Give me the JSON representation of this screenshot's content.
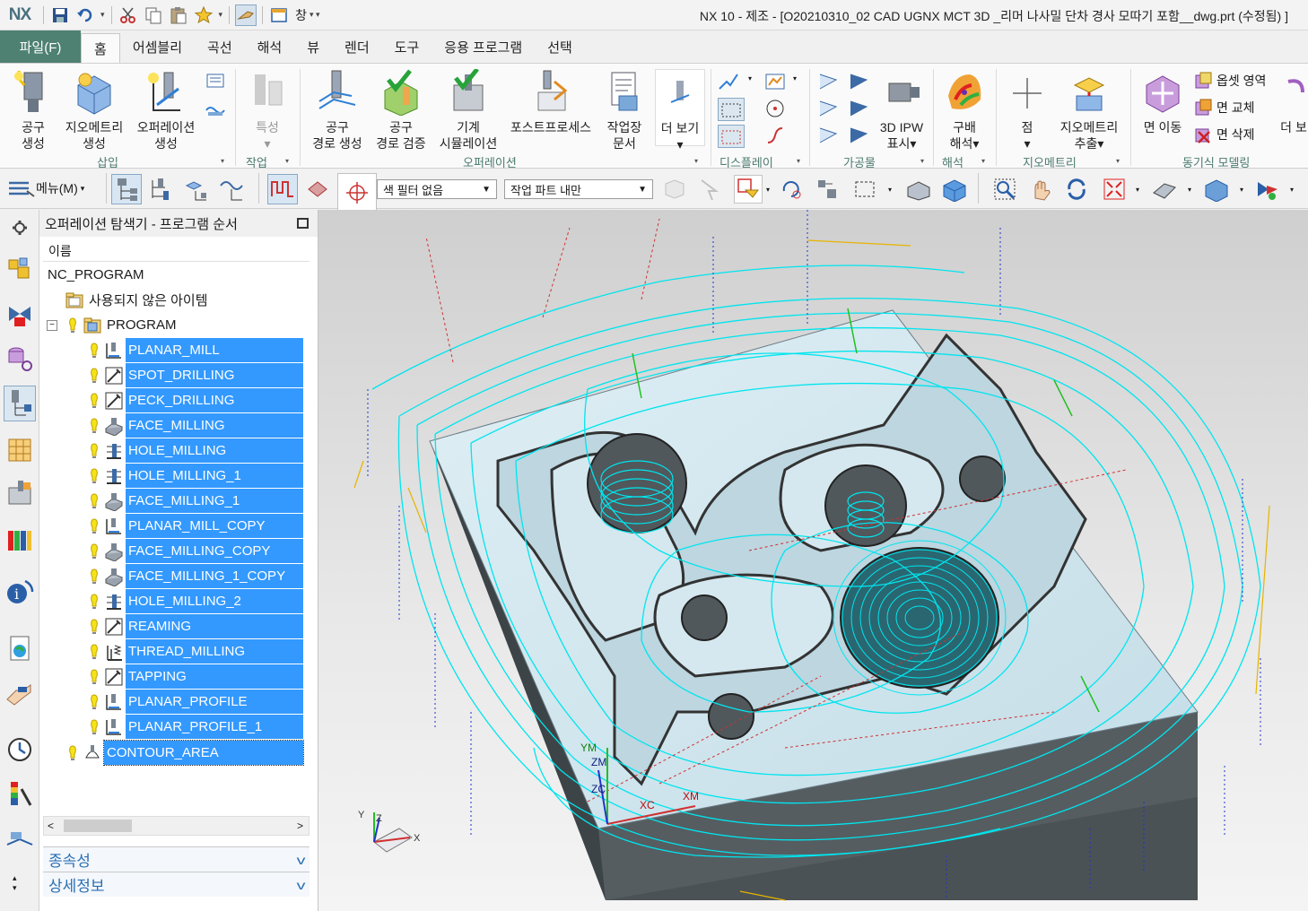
{
  "app": {
    "logo": "NX",
    "window_menu": "창",
    "title": "NX 10 - 제조 - [O20210310_02 CAD UGNX MCT 3D _리머 나사밀 단차 경사 모따기 포함__dwg.prt (수정됨) ]"
  },
  "menu": {
    "file": "파일(F)",
    "tabs": [
      "홈",
      "어셈블리",
      "곡선",
      "해석",
      "뷰",
      "렌더",
      "도구",
      "응용 프로그램",
      "선택"
    ]
  },
  "ribbon": {
    "buttons": {
      "tool_create": "공구\n생성",
      "geometry_create": "지오메트리\n생성",
      "operation_create": "오퍼레이션\n생성",
      "feature": "특성",
      "toolpath_generate": "공구\n경로 생성",
      "toolpath_verify": "공구\n경로 검증",
      "machine_sim": "기계\n시뮬레이션",
      "postprocess": "포스트프로세스",
      "shop_doc": "작업장\n문서",
      "more": "더 보기",
      "ipw_3d": "3D IPW\n표시",
      "gradient": "구배\n해석",
      "point": "점",
      "geometry_extract": "지오메트리\n추출",
      "face_move": "면 이동",
      "more2": "더 보"
    },
    "sync": {
      "offset_region": "옵셋 영역",
      "face_replace": "면 교체",
      "face_delete": "면 삭제"
    },
    "groups": {
      "insert": "삽입",
      "job": "작업",
      "operation": "오퍼레이션",
      "display": "디스플레이",
      "workpiece": "가공물",
      "analysis": "해석",
      "geometry": "지오메트리",
      "sync_modeling": "동기식 모델링"
    }
  },
  "toolbar": {
    "menu": "메뉴(M)",
    "type_filter": "색 필터 없음",
    "scope": "작업 파트 내만"
  },
  "navigator": {
    "title": "오퍼레이션 탐색기 - 프로그램 순서",
    "column": "이름",
    "root": "NC_PROGRAM",
    "unused": "사용되지 않은 아이템",
    "program": "PROGRAM",
    "operations": [
      {
        "name": "PLANAR_MILL",
        "icon": "planar-mill-icon"
      },
      {
        "name": "SPOT_DRILLING",
        "icon": "drilling-icon"
      },
      {
        "name": "PECK_DRILLING",
        "icon": "drilling-icon"
      },
      {
        "name": "FACE_MILLING",
        "icon": "face-milling-icon"
      },
      {
        "name": "HOLE_MILLING",
        "icon": "hole-milling-icon"
      },
      {
        "name": "HOLE_MILLING_1",
        "icon": "hole-milling-icon"
      },
      {
        "name": "FACE_MILLING_1",
        "icon": "face-milling-icon"
      },
      {
        "name": "PLANAR_MILL_COPY",
        "icon": "planar-mill-icon"
      },
      {
        "name": "FACE_MILLING_COPY",
        "icon": "face-milling-icon"
      },
      {
        "name": "FACE_MILLING_1_COPY",
        "icon": "face-milling-icon"
      },
      {
        "name": "HOLE_MILLING_2",
        "icon": "hole-milling-icon"
      },
      {
        "name": "REAMING",
        "icon": "drilling-icon"
      },
      {
        "name": "THREAD_MILLING",
        "icon": "thread-milling-icon"
      },
      {
        "name": "TAPPING",
        "icon": "drilling-icon"
      },
      {
        "name": "PLANAR_PROFILE",
        "icon": "planar-mill-icon"
      },
      {
        "name": "PLANAR_PROFILE_1",
        "icon": "planar-mill-icon"
      }
    ],
    "contour": "CONTOUR_AREA",
    "dependencies": "종속성",
    "details": "상세정보"
  },
  "viewport": {
    "axis_labels": {
      "ym": "YM",
      "zm": "ZM",
      "zc": "ZC",
      "xc": "XC",
      "xm": "XM",
      "y": "Y",
      "z": "Z",
      "x": "X"
    }
  },
  "colors": {
    "accent": "#4f8173",
    "selection": "#3399ff",
    "toolpath": "#00e5ee",
    "part_top": "#cfe4ec",
    "part_side": "#4a5256"
  }
}
